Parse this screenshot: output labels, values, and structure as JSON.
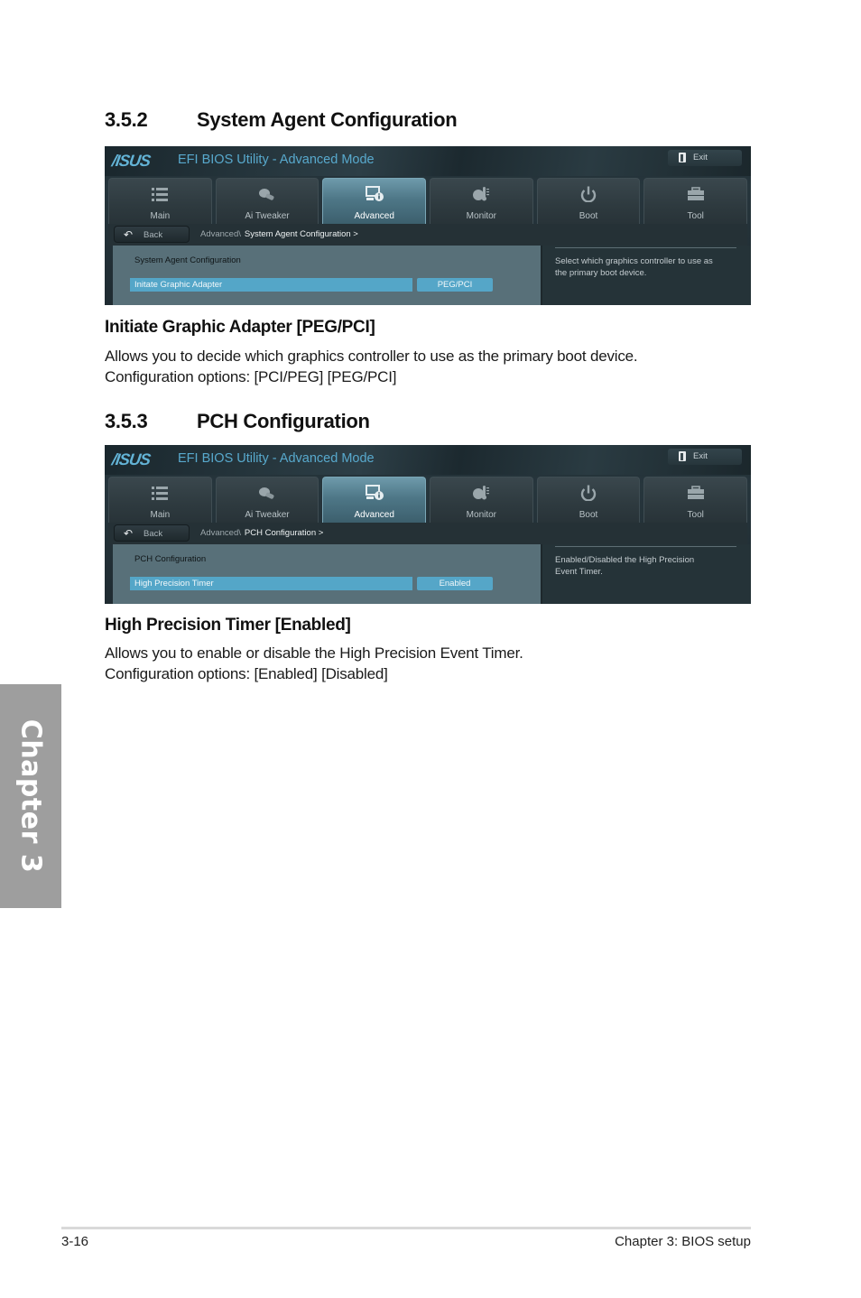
{
  "sections": [
    {
      "number": "3.5.2",
      "title": "System Agent Configuration",
      "bios": {
        "logo": "/ISUS",
        "app_title": "EFI BIOS Utility - Advanced Mode",
        "exit_label": "Exit",
        "tabs": [
          {
            "label": "Main",
            "icon": "list-icon",
            "active": false
          },
          {
            "label": "Ai  Tweaker",
            "icon": "tweaker-icon",
            "active": false
          },
          {
            "label": "Advanced",
            "icon": "advanced-info-icon",
            "active": true
          },
          {
            "label": "Monitor",
            "icon": "thermometer-icon",
            "active": false
          },
          {
            "label": "Boot",
            "icon": "power-icon",
            "active": false
          },
          {
            "label": "Tool",
            "icon": "toolbox-icon",
            "active": false
          }
        ],
        "back_label": "Back",
        "breadcrumb_parent": "Advanced\\",
        "breadcrumb_current": "System Agent Configuration  >",
        "group_title": "System Agent Configuration",
        "item_label": "Initate Graphic Adapter",
        "item_value": "PEG/PCI",
        "help_text": "Select which graphics controller to use as the primary boot device."
      },
      "item_heading": "Initiate Graphic Adapter [PEG/PCI]",
      "description_line1": "Allows you to decide which graphics controller to use as the primary boot device.",
      "description_line2": "Configuration options: [PCI/PEG] [PEG/PCI]"
    },
    {
      "number": "3.5.3",
      "title": "PCH Configuration",
      "bios": {
        "logo": "/ISUS",
        "app_title": "EFI BIOS Utility - Advanced Mode",
        "exit_label": "Exit",
        "tabs": [
          {
            "label": "Main",
            "icon": "list-icon",
            "active": false
          },
          {
            "label": "Ai  Tweaker",
            "icon": "tweaker-icon",
            "active": false
          },
          {
            "label": "Advanced",
            "icon": "advanced-info-icon",
            "active": true
          },
          {
            "label": "Monitor",
            "icon": "thermometer-icon",
            "active": false
          },
          {
            "label": "Boot",
            "icon": "power-icon",
            "active": false
          },
          {
            "label": "Tool",
            "icon": "toolbox-icon",
            "active": false
          }
        ],
        "back_label": "Back",
        "breadcrumb_parent": "Advanced\\",
        "breadcrumb_current": "PCH Configuration  >",
        "group_title": "PCH Configuration",
        "item_label": "High Precision Timer",
        "item_value": "Enabled",
        "help_text": "Enabled/Disabled the High Precision Event Timer."
      },
      "item_heading": "High Precision Timer [Enabled]",
      "description_line1": "Allows you to enable or disable the High Precision Event Timer.",
      "description_line2": "Configuration options: [Enabled] [Disabled]"
    }
  ],
  "chapter_tab": "Chapter 3",
  "footer": {
    "page_number": "3-16",
    "chapter_title": "Chapter 3: BIOS setup"
  },
  "colors": {
    "bios_accent": "#55a6c8",
    "bios_title": "#58a9cd",
    "chapter_tab_bg": "#9e9e9e"
  }
}
